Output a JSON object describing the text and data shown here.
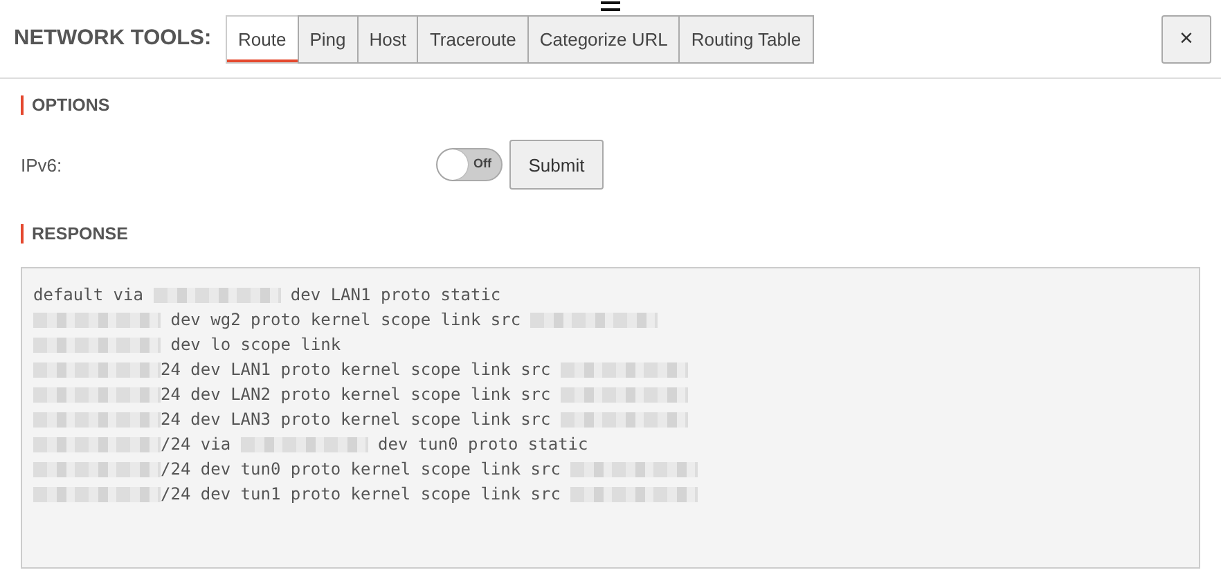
{
  "header": {
    "title": "NETWORK TOOLS:",
    "close": "×"
  },
  "tabs": [
    {
      "label": "Route",
      "selected": true
    },
    {
      "label": "Ping",
      "selected": false
    },
    {
      "label": "Host",
      "selected": false
    },
    {
      "label": "Traceroute",
      "selected": false
    },
    {
      "label": "Categorize URL",
      "selected": false
    },
    {
      "label": "Routing Table",
      "selected": false
    }
  ],
  "options": {
    "heading": "OPTIONS",
    "ipv6": {
      "label": "IPv6:",
      "on": false,
      "state_text": "Off"
    },
    "submit": "Submit"
  },
  "response": {
    "heading": "RESPONSE",
    "lines": [
      [
        {
          "kind": "text",
          "text": "default via "
        },
        {
          "kind": "redacted"
        },
        {
          "kind": "text",
          "text": " dev LAN1 proto static"
        }
      ],
      [
        {
          "kind": "redacted"
        },
        {
          "kind": "text",
          "text": " dev wg2 proto kernel scope link src "
        },
        {
          "kind": "redacted"
        }
      ],
      [
        {
          "kind": "redacted"
        },
        {
          "kind": "text",
          "text": " dev lo scope link"
        }
      ],
      [
        {
          "kind": "redacted"
        },
        {
          "kind": "text",
          "text": "24 dev LAN1 proto kernel scope link src "
        },
        {
          "kind": "redacted"
        }
      ],
      [
        {
          "kind": "redacted"
        },
        {
          "kind": "text",
          "text": "24 dev LAN2 proto kernel scope link src "
        },
        {
          "kind": "redacted"
        }
      ],
      [
        {
          "kind": "redacted"
        },
        {
          "kind": "text",
          "text": "24 dev LAN3 proto kernel scope link src "
        },
        {
          "kind": "redacted"
        }
      ],
      [
        {
          "kind": "redacted"
        },
        {
          "kind": "text",
          "text": "/24 via "
        },
        {
          "kind": "redacted"
        },
        {
          "kind": "text",
          "text": " dev tun0 proto static"
        }
      ],
      [
        {
          "kind": "redacted"
        },
        {
          "kind": "text",
          "text": "/24 dev tun0 proto kernel scope link src "
        },
        {
          "kind": "redacted"
        }
      ],
      [
        {
          "kind": "redacted"
        },
        {
          "kind": "text",
          "text": "/24 dev tun1 proto kernel scope link src "
        },
        {
          "kind": "redacted"
        }
      ]
    ]
  }
}
